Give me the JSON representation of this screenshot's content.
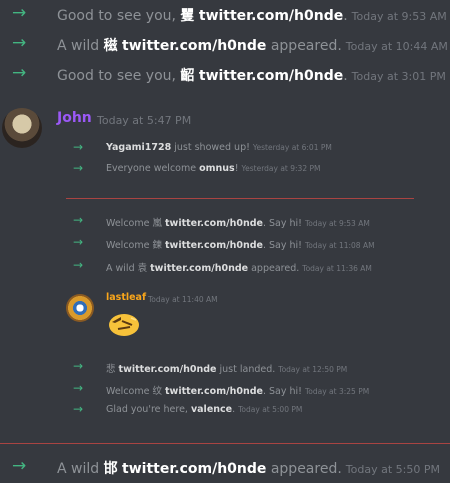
{
  "messages_top": [
    {
      "pre": "Good to see you, ",
      "glyph": "矍",
      "bold": "twitter.com/h0nde",
      "post": ".",
      "ts": "Today at 9:53 AM"
    },
    {
      "pre": "A wild ",
      "glyph": "稵",
      "bold": "twitter.com/h0nde",
      "post": " appeared.",
      "ts": "Today at 10:44 AM"
    },
    {
      "pre": "Good to see you, ",
      "glyph": "齠",
      "bold": "twitter.com/h0nde",
      "post": ".",
      "ts": "Today at 3:01 PM"
    }
  ],
  "john": {
    "name": "John",
    "ts": "Today at 5:47 PM"
  },
  "john_messages": [
    {
      "pre": "",
      "bold": "Yagami1728",
      "post": " just showed up!",
      "ts": "Yesterday at 6:01 PM"
    },
    {
      "pre": "Everyone welcome ",
      "bold": "omnus",
      "post": "!",
      "ts": "Yesterday at 9:32 PM"
    }
  ],
  "mid_messages": [
    {
      "pre": "Welcome 嵐 ",
      "bold": "twitter.com/h0nde",
      "post": ". Say hi!",
      "ts": "Today at 9:53 AM"
    },
    {
      "pre": "Welcome 鍊 ",
      "bold": "twitter.com/h0nde",
      "post": ". Say hi!",
      "ts": "Today at 11:08 AM"
    },
    {
      "pre": "A wild 袁 ",
      "bold": "twitter.com/h0nde",
      "post": " appeared.",
      "ts": "Today at 11:36 AM"
    }
  ],
  "lastleaf": {
    "name": "lastleaf",
    "ts": "Today at 11:40 AM"
  },
  "low_messages": [
    {
      "pre": "悲 ",
      "bold": "twitter.com/h0nde",
      "post": " just landed.",
      "ts": "Today at 12:50 PM"
    },
    {
      "pre": "Welcome 纹 ",
      "bold": "twitter.com/h0nde",
      "post": ". Say hi!",
      "ts": "Today at 3:25 PM"
    },
    {
      "pre": "Glad you're here, ",
      "bold": "valence",
      "post": ".",
      "ts": "Today at 5:00 PM"
    }
  ],
  "bottom_message": {
    "pre": "A wild ",
    "glyph": "邯",
    "bold": "twitter.com/h0nde",
    "post": " appeared.",
    "ts": "Today at 5:50 PM"
  },
  "arrow": "→",
  "colors": {
    "background": "#36393f",
    "join_arrow": "#43b581",
    "john_name": "#9b59f6",
    "lastleaf_name": "#faa61a",
    "new_divider": "#a94442"
  }
}
